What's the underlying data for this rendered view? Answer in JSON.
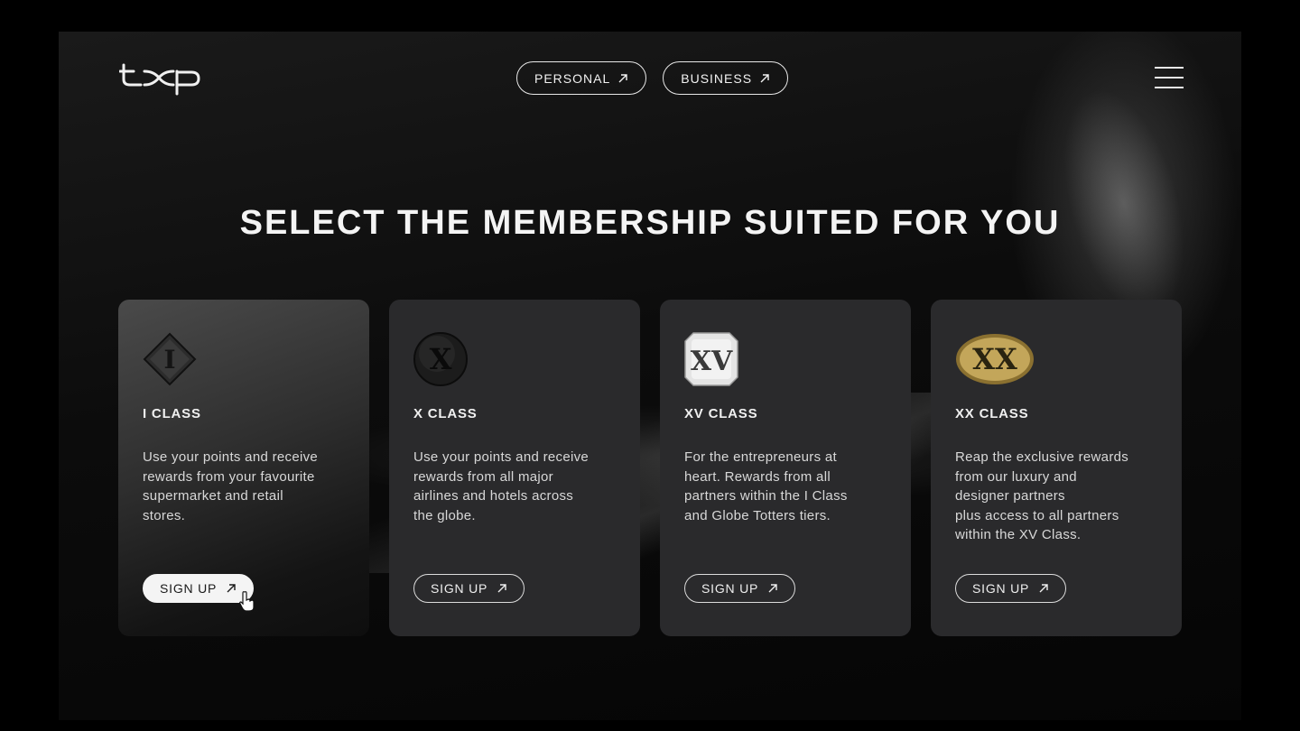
{
  "brand": {
    "logo_text": "txp"
  },
  "nav": {
    "personal_label": "PERSONAL",
    "business_label": "BUSINESS"
  },
  "headline": "SELECT THE MEMBERSHIP SUITED FOR YOU",
  "cards": [
    {
      "badge": "I",
      "title": "I CLASS",
      "description": "Use your points and receive\nrewards from your favourite\nsupermarket and retail\nstores.",
      "button": "SIGN UP",
      "state": "hovered"
    },
    {
      "badge": "X",
      "title": "X CLASS",
      "description": "Use your points and receive\nrewards from all major\nairlines and hotels across\nthe globe.",
      "button": "SIGN UP"
    },
    {
      "badge": "XV",
      "title": "XV CLASS",
      "description": "For the entrepreneurs at\nheart. Rewards from all\npartners within the I Class\nand Globe Totters tiers.",
      "button": "SIGN UP"
    },
    {
      "badge": "XX",
      "title": "XX CLASS",
      "description": "Reap the exclusive rewards\nfrom our luxury and\ndesigner partners\nplus access to all partners\nwithin the XV Class.",
      "button": "SIGN UP"
    }
  ],
  "colors": {
    "background": "#000000",
    "card": "#2a2a2c",
    "text": "#f0f0f0",
    "gold_badge": "#b89a48"
  },
  "icons": [
    "arrow-up-right-icon",
    "hamburger-menu-icon",
    "hand-pointer-cursor"
  ]
}
